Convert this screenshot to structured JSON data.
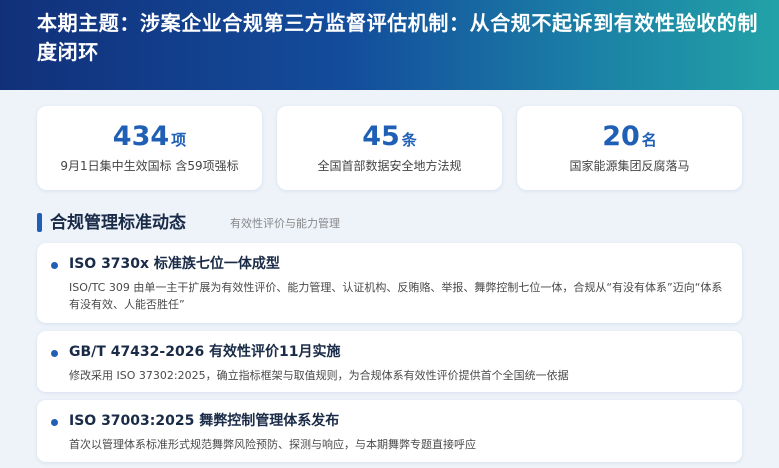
{
  "header": {
    "title": "本期主题：涉案企业合规第三方监督评估机制：从合规不起诉到有效性验收的制度闭环"
  },
  "stats": [
    {
      "value": "434",
      "unit": "项",
      "desc": "9月1日集中生效国标 含59项强标"
    },
    {
      "value": "45",
      "unit": "条",
      "desc": "全国首部数据安全地方法规"
    },
    {
      "value": "20",
      "unit": "名",
      "desc": "国家能源集团反腐落马"
    }
  ],
  "section": {
    "title": "合规管理标准动态",
    "subtitle": "有效性评价与能力管理"
  },
  "items": [
    {
      "title": "ISO 3730x 标准族七位一体成型",
      "body": "ISO/TC 309 由单一主干扩展为有效性评价、能力管理、认证机构、反贿赂、举报、舞弊控制七位一体，合规从“有没有体系”迈向“体系有没有效、人能否胜任”"
    },
    {
      "title": "GB/T 47432-2026 有效性评价11月实施",
      "body": "修改采用 ISO 37302:2025，确立指标框架与取值规则，为合规体系有效性评价提供首个全国统一依据"
    },
    {
      "title": "ISO 37003:2025 舞弊控制管理体系发布",
      "body": "首次以管理体系标准形式规范舞弊风险预防、探测与响应，与本期舞弊专题直接呼应"
    }
  ],
  "colors": {
    "accent": "#1f5fb6",
    "header_start": "#12307a",
    "header_end": "#22a2a7",
    "background": "#eef3fa"
  }
}
